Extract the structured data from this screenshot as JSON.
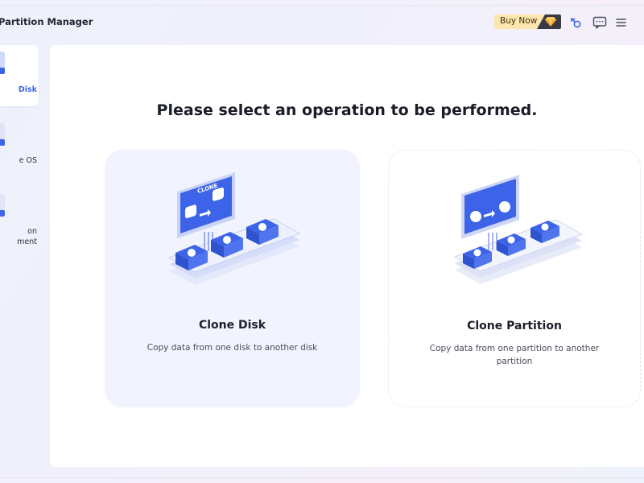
{
  "app": {
    "title": "Partition Manager"
  },
  "toolbar": {
    "buy_label": "Buy Now",
    "icons": [
      "gem-icon",
      "key-icon",
      "feedback-icon",
      "menu-icon"
    ]
  },
  "sidebar": {
    "items": [
      {
        "label_lines": [
          "Disk"
        ],
        "active": true
      },
      {
        "label_lines": [
          "e OS"
        ],
        "active": false
      },
      {
        "label_lines": [
          "on",
          "ment"
        ],
        "active": false
      }
    ]
  },
  "main": {
    "heading": "Please select an operation to be performed.",
    "cards": [
      {
        "title": "Clone Disk",
        "description": "Copy data from one disk to another disk",
        "selected": true
      },
      {
        "title": "Clone Partition",
        "description": "Copy data from one partition to another partition",
        "selected": false
      }
    ],
    "illustration_text": "CLONE"
  },
  "colors": {
    "accent": "#3d64e8",
    "buy_bg": "#fde6ad",
    "selected_card_bg": "#f1f3fe"
  }
}
